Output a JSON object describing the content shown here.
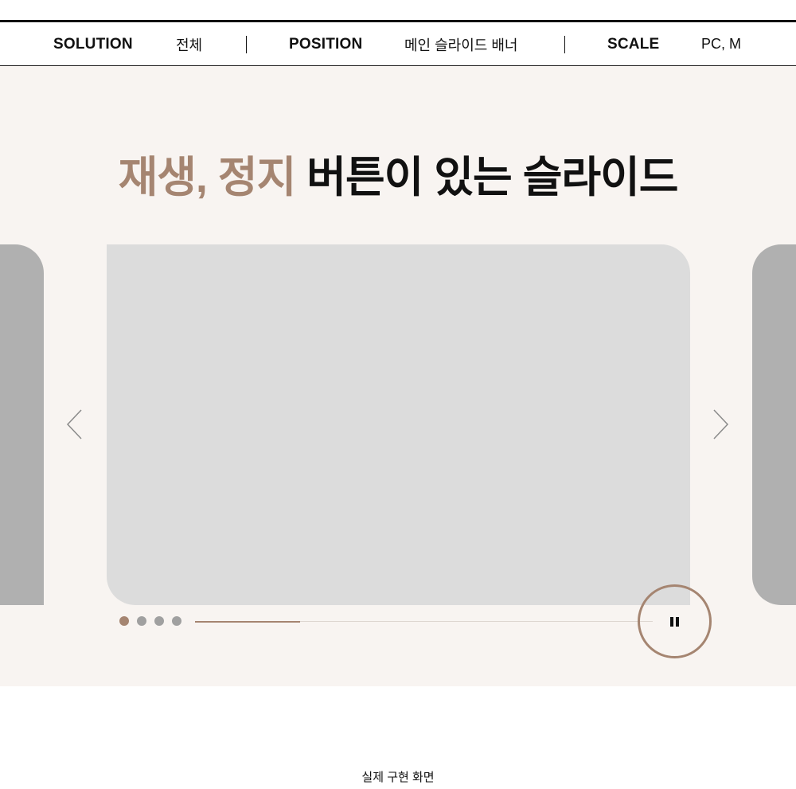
{
  "infobar": {
    "solution_label": "SOLUTION",
    "solution_value": "전체",
    "position_label": "POSITION",
    "position_value": "메인 슬라이드 배너",
    "scale_label": "SCALE",
    "scale_value": "PC, M"
  },
  "hero": {
    "title_accent": "재생, 정지",
    "title_rest": " 버튼이 있는 슬라이드"
  },
  "slider": {
    "prev_icon": "chevron-left-icon",
    "next_icon": "chevron-right-icon",
    "pause_icon": "pause-icon",
    "slide_count": 4,
    "active_index": 0,
    "progress_fraction": 0.23
  },
  "colors": {
    "accent": "#a58571",
    "stage_bg": "#f8f4f1",
    "slide_main": "#dcdcdc",
    "slide_side": "#b0b0b0",
    "dot_inactive": "#a0a0a0"
  },
  "footer": {
    "caption": "실제 구현 화면"
  }
}
